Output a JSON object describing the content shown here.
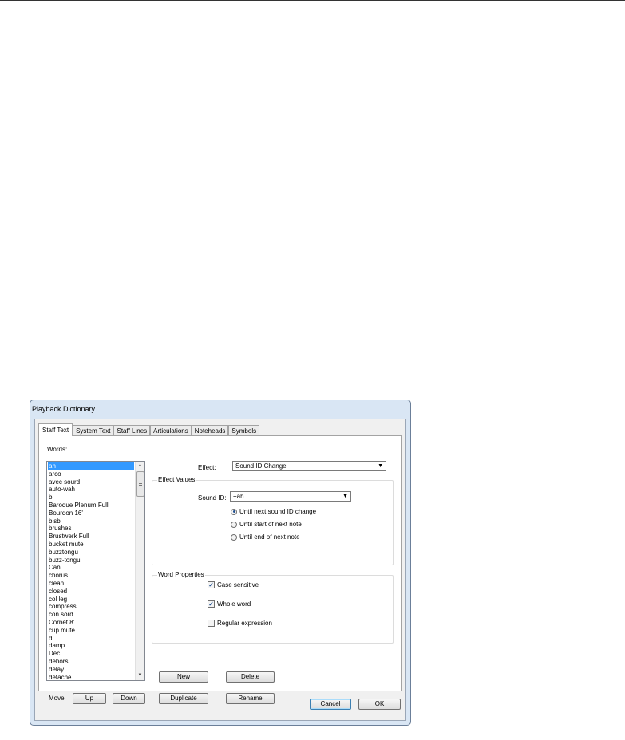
{
  "window": {
    "title": "Playback Dictionary"
  },
  "tabs": [
    {
      "label": "Staff Text",
      "active": true
    },
    {
      "label": "System Text",
      "active": false
    },
    {
      "label": "Staff Lines",
      "active": false
    },
    {
      "label": "Articulations",
      "active": false
    },
    {
      "label": "Noteheads",
      "active": false
    },
    {
      "label": "Symbols",
      "active": false
    }
  ],
  "words": {
    "label": "Words:",
    "items": [
      "ah",
      "arco",
      "avec sourd",
      "auto-wah",
      "b",
      "Baroque Plenum Full",
      "Bourdon 16'",
      "bisb",
      "brushes",
      "Brustwerk Full",
      "bucket mute",
      "buzztongu",
      "buzz-tongu",
      "Can",
      "chorus",
      "clean",
      "closed",
      "col leg",
      "compress",
      "con sord",
      "Cornet 8'",
      "cup mute",
      "d",
      "damp",
      "Dec",
      "dehors",
      "delay",
      "detache"
    ],
    "selected_index": 0
  },
  "move": {
    "label": "Move",
    "up": "Up",
    "down": "Down"
  },
  "effect": {
    "label": "Effect:",
    "value": "Sound ID Change"
  },
  "effect_values": {
    "title": "Effect Values",
    "sound_id_label": "Sound ID:",
    "sound_id_value": "+ah",
    "options": [
      {
        "label": "Until next sound ID change",
        "selected": true
      },
      {
        "label": "Until start of next note",
        "selected": false
      },
      {
        "label": "Until end of next note",
        "selected": false
      }
    ]
  },
  "word_properties": {
    "title": "Word Properties",
    "case_sensitive": {
      "label": "Case sensitive",
      "checked": true
    },
    "whole_word": {
      "label": "Whole word",
      "checked": true
    },
    "regular_expression": {
      "label": "Regular expression",
      "checked": false
    }
  },
  "buttons": {
    "new": "New",
    "delete": "Delete",
    "duplicate": "Duplicate",
    "rename": "Rename",
    "cancel": "Cancel",
    "ok": "OK"
  }
}
